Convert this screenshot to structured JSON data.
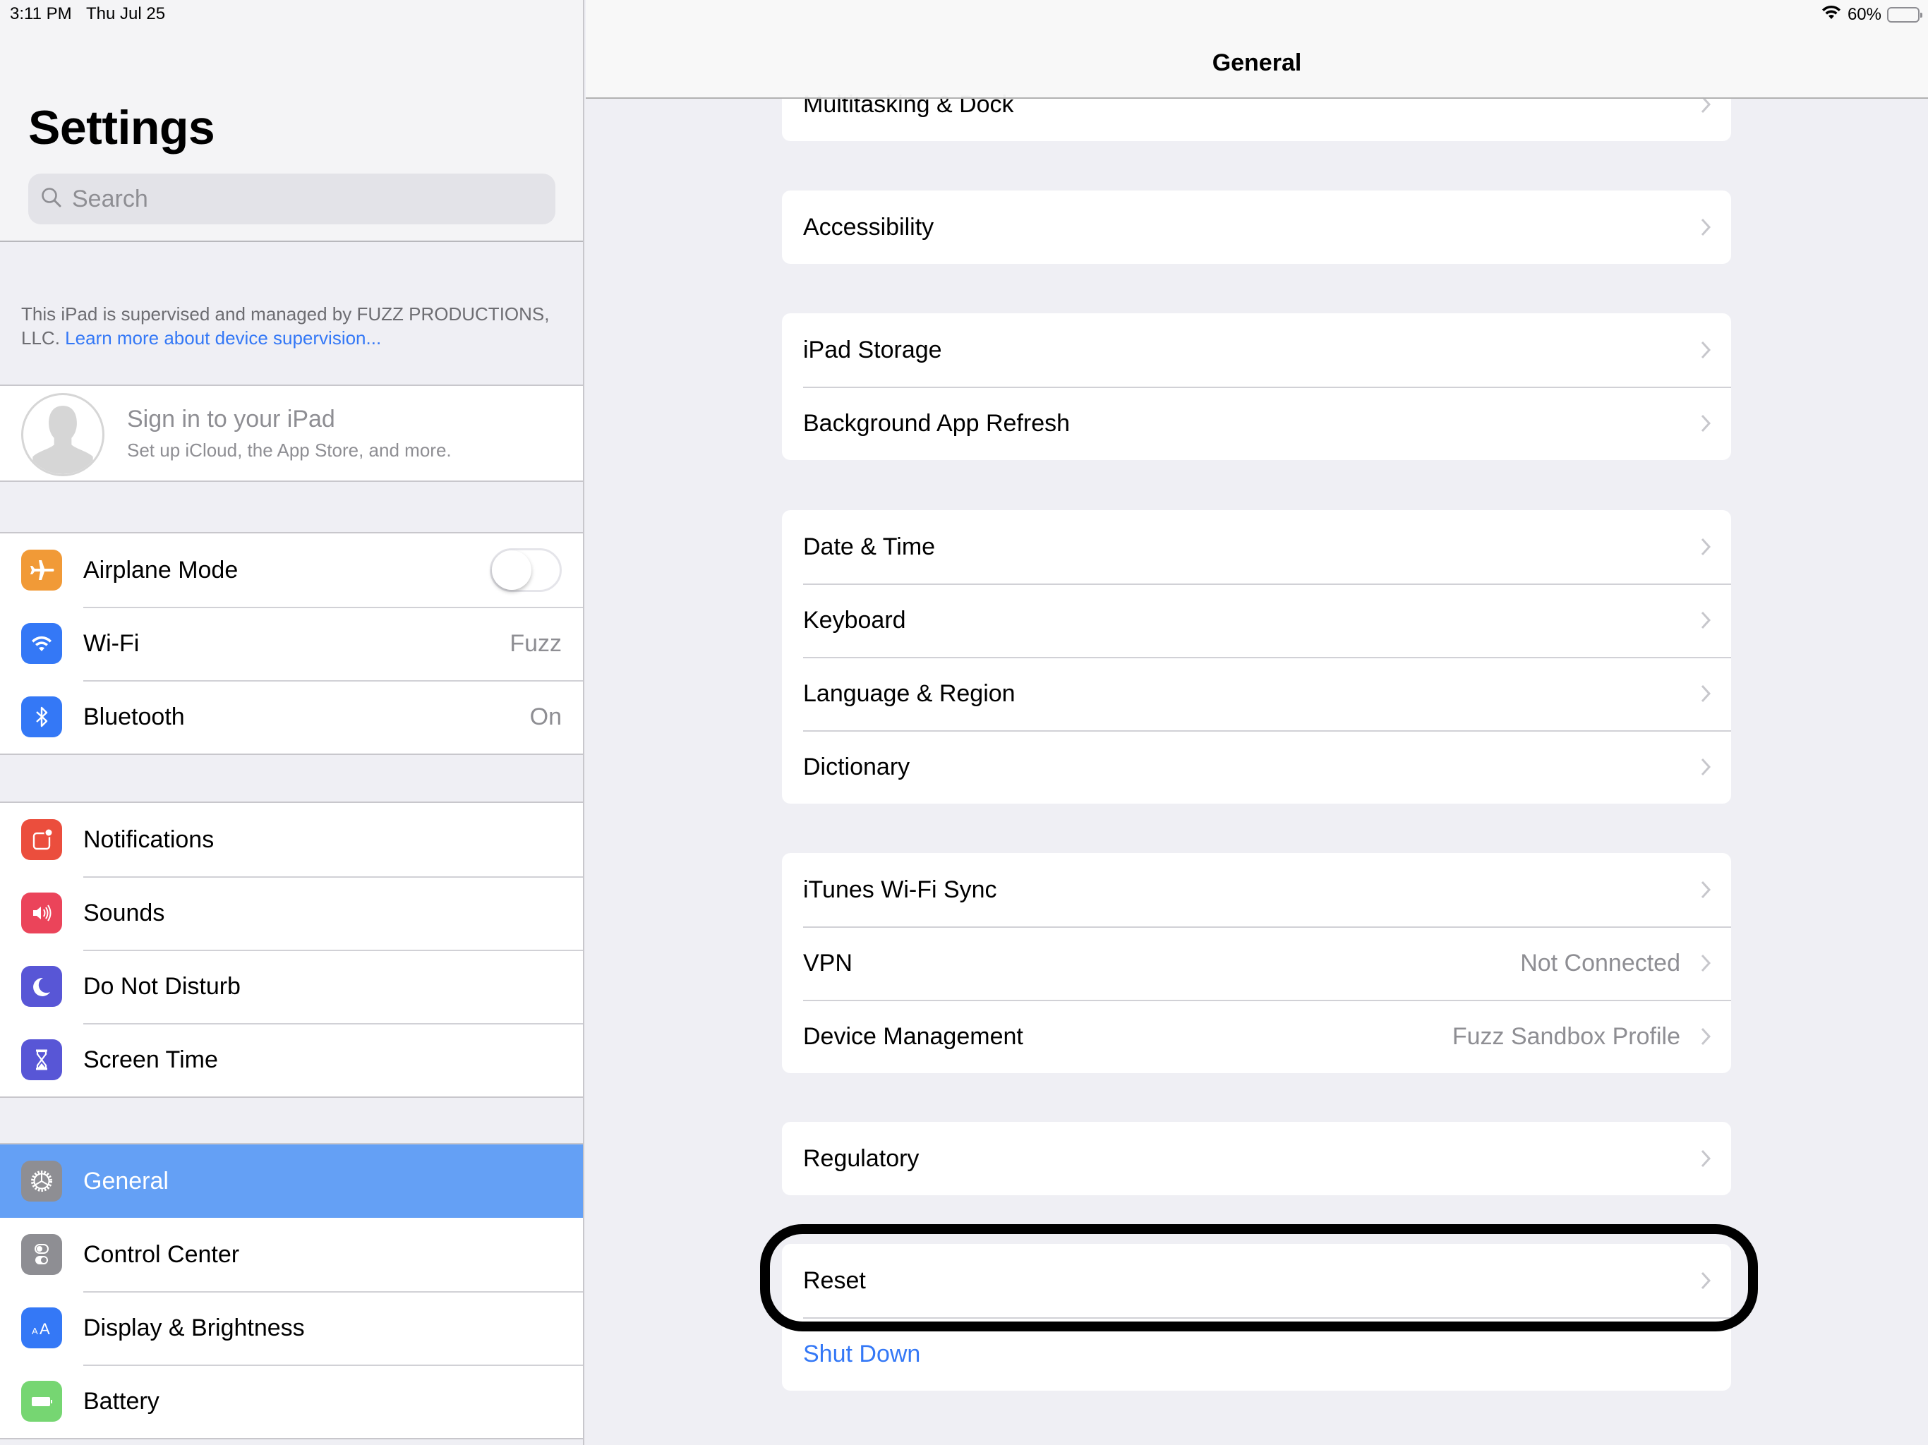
{
  "status_bar": {
    "time": "3:11 PM",
    "date": "Thu Jul 25",
    "battery_percent": "60%",
    "battery_level": 0.6,
    "wifi_icon": "wifi-icon"
  },
  "sidebar": {
    "title": "Settings",
    "search_placeholder": "Search",
    "supervision_text": "This iPad is supervised and managed by FUZZ PRODUCTIONS, LLC. ",
    "supervision_link": "Learn more about device supervision...",
    "signin": {
      "title": "Sign in to your iPad",
      "subtitle": "Set up iCloud, the App Store, and more."
    },
    "groups": [
      [
        {
          "label": "Airplane Mode",
          "icon": "airplane-icon",
          "color": "#f19a37",
          "toggle": false
        },
        {
          "label": "Wi-Fi",
          "icon": "wifi-icon",
          "color": "#3478f6",
          "value": "Fuzz"
        },
        {
          "label": "Bluetooth",
          "icon": "bluetooth-icon",
          "color": "#3478f6",
          "value": "On"
        }
      ],
      [
        {
          "label": "Notifications",
          "icon": "notifications-icon",
          "color": "#eb4e3d"
        },
        {
          "label": "Sounds",
          "icon": "speaker-icon",
          "color": "#eb445a"
        },
        {
          "label": "Do Not Disturb",
          "icon": "moon-icon",
          "color": "#5856d6"
        },
        {
          "label": "Screen Time",
          "icon": "hourglass-icon",
          "color": "#5856d6"
        }
      ],
      [
        {
          "label": "General",
          "icon": "gear-icon",
          "color": "#8e8e93",
          "selected": true
        },
        {
          "label": "Control Center",
          "icon": "switches-icon",
          "color": "#8e8e93"
        },
        {
          "label": "Display & Brightness",
          "icon": "text-size-icon",
          "color": "#3478f6"
        },
        {
          "label": "Battery",
          "icon": "battery-icon",
          "color": "#76d672"
        }
      ]
    ]
  },
  "detail": {
    "title": "General",
    "groups": [
      [
        {
          "label": "Multitasking & Dock"
        }
      ],
      [
        {
          "label": "Accessibility"
        }
      ],
      [
        {
          "label": "iPad Storage"
        },
        {
          "label": "Background App Refresh"
        }
      ],
      [
        {
          "label": "Date & Time"
        },
        {
          "label": "Keyboard"
        },
        {
          "label": "Language & Region"
        },
        {
          "label": "Dictionary"
        }
      ],
      [
        {
          "label": "iTunes Wi-Fi Sync"
        },
        {
          "label": "VPN",
          "value": "Not Connected"
        },
        {
          "label": "Device Management",
          "value": "Fuzz Sandbox Profile"
        }
      ],
      [
        {
          "label": "Regulatory"
        }
      ],
      [
        {
          "label": "Reset",
          "highlighted": true
        },
        {
          "label": "Shut Down",
          "link": true
        }
      ]
    ]
  },
  "colors": {
    "accent": "#3478f6",
    "selection": "#64a0f5",
    "background": "#efeff4"
  }
}
